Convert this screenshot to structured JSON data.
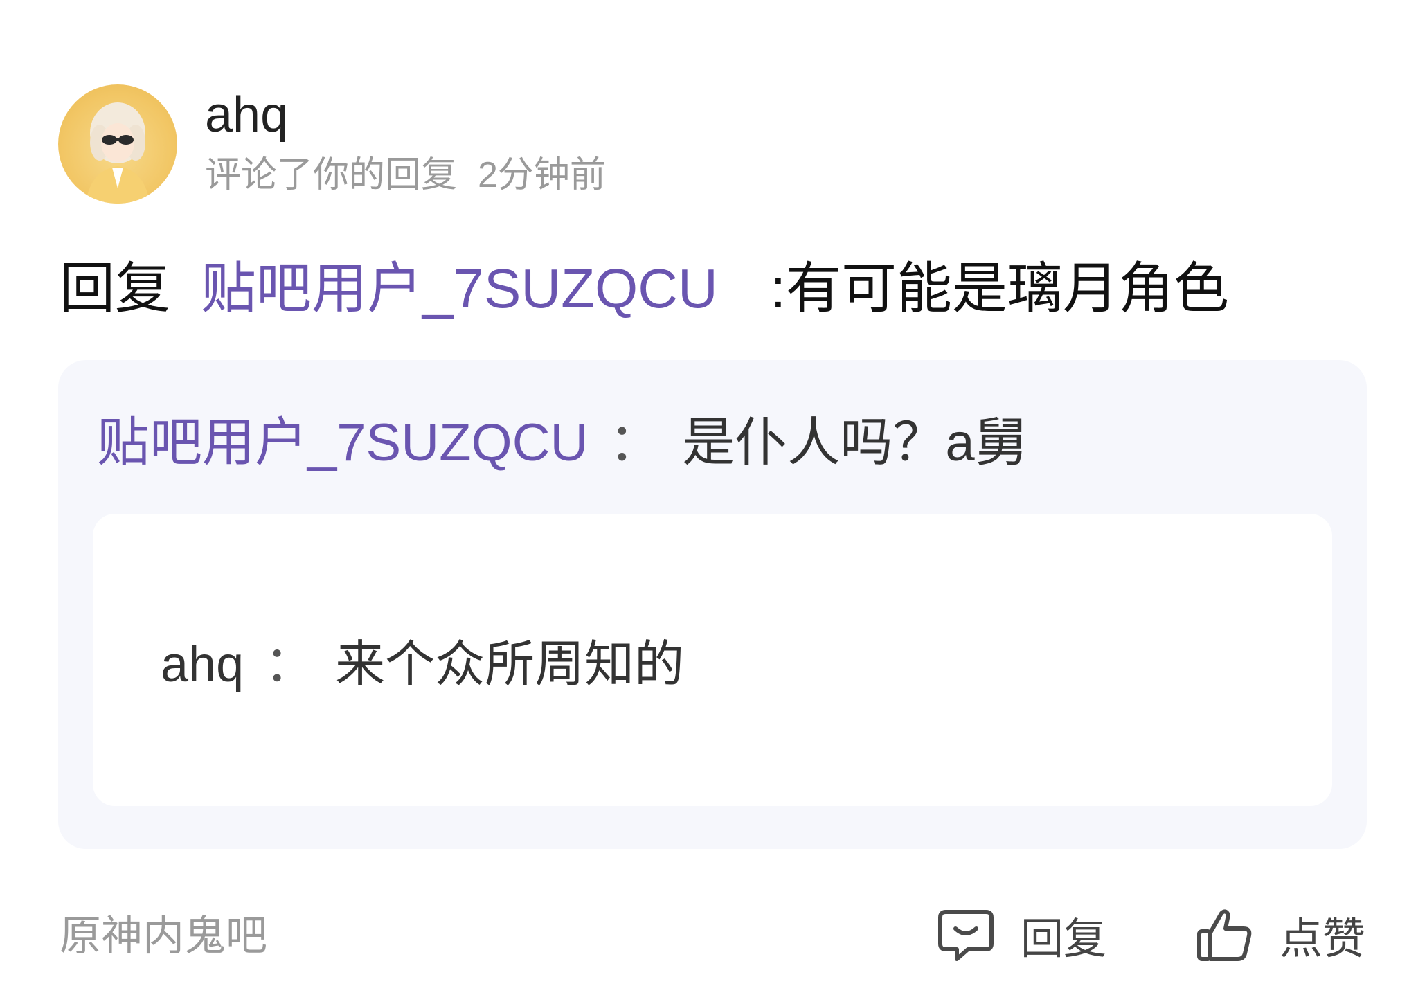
{
  "header": {
    "username": "ahq",
    "action_text": "评论了你的回复",
    "timestamp": "2分钟前"
  },
  "reply": {
    "prefix": "回复",
    "mention": "贴吧用户_7SUZQCU",
    "text": ":有可能是璃月角色"
  },
  "quote": {
    "author": "贴吧用户_7SUZQCU",
    "separator": "：",
    "text": "是仆人吗？a舅",
    "nested": {
      "author": "ahq",
      "separator": "：",
      "text": "来个众所周知的"
    }
  },
  "footer": {
    "forum": "原神内鬼吧",
    "reply_label": "回复",
    "like_label": "点赞"
  },
  "colors": {
    "mention": "#6a55b0",
    "muted": "#9a9a9a",
    "card_bg": "#f6f7fc"
  },
  "icons": [
    "comment-icon",
    "thumbs-up-icon"
  ]
}
